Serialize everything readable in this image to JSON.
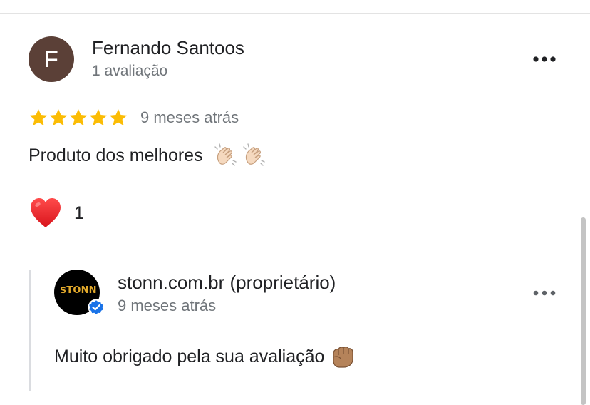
{
  "review": {
    "avatar_initial": "F",
    "avatar_color": "#5b4037",
    "reviewer_name": "Fernando Santoos",
    "reviewer_meta": "1 avaliação",
    "rating": 5,
    "rating_max": 5,
    "star_color": "#fbbc04",
    "time": "9 meses atrás",
    "text": "Produto dos melhores",
    "text_emoji": [
      "clapping-hands",
      "clapping-hands"
    ],
    "reaction": {
      "icon": "heart-icon",
      "count": "1"
    },
    "more_icon": "more-horizontal-icon"
  },
  "owner_reply": {
    "avatar_logo_text": "$TONN",
    "avatar_logo_color": "#e2a92b",
    "verified_icon": "verified-badge-icon",
    "verified_color": "#1a73e8",
    "name": "stonn.com.br (proprietário)",
    "time": "9 meses atrás",
    "text": "Muito obrigado pela sua avaliação",
    "text_emoji": [
      "fist-bump"
    ],
    "more_icon": "more-horizontal-icon"
  }
}
